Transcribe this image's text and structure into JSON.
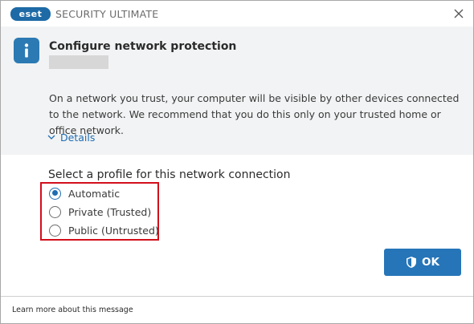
{
  "window": {
    "brand": "eset",
    "product_name": "SECURITY ULTIMATE",
    "close_icon": "close-icon"
  },
  "header": {
    "icon": "info-icon",
    "title": "Configure network protection",
    "network_name": "",
    "description": "On a network you trust, your computer will be visible by other devices connected to the network. We recommend that you do this only on your trusted home or office network.",
    "details_label": "Details",
    "details_icon": "chevron-down-icon"
  },
  "profile": {
    "prompt": "Select a profile for this network connection",
    "options": [
      {
        "label": "Automatic",
        "checked": true
      },
      {
        "label": "Private (Trusted)",
        "checked": false
      },
      {
        "label": "Public (Untrusted)",
        "checked": false
      }
    ]
  },
  "actions": {
    "ok_label": "OK",
    "ok_icon": "shield-icon"
  },
  "footer": {
    "learn_more": "Learn more about this message"
  },
  "colors": {
    "accent": "#2675b8",
    "link": "#1f6db3",
    "highlight": "#d20f1b",
    "header_bg": "#f2f3f4"
  }
}
